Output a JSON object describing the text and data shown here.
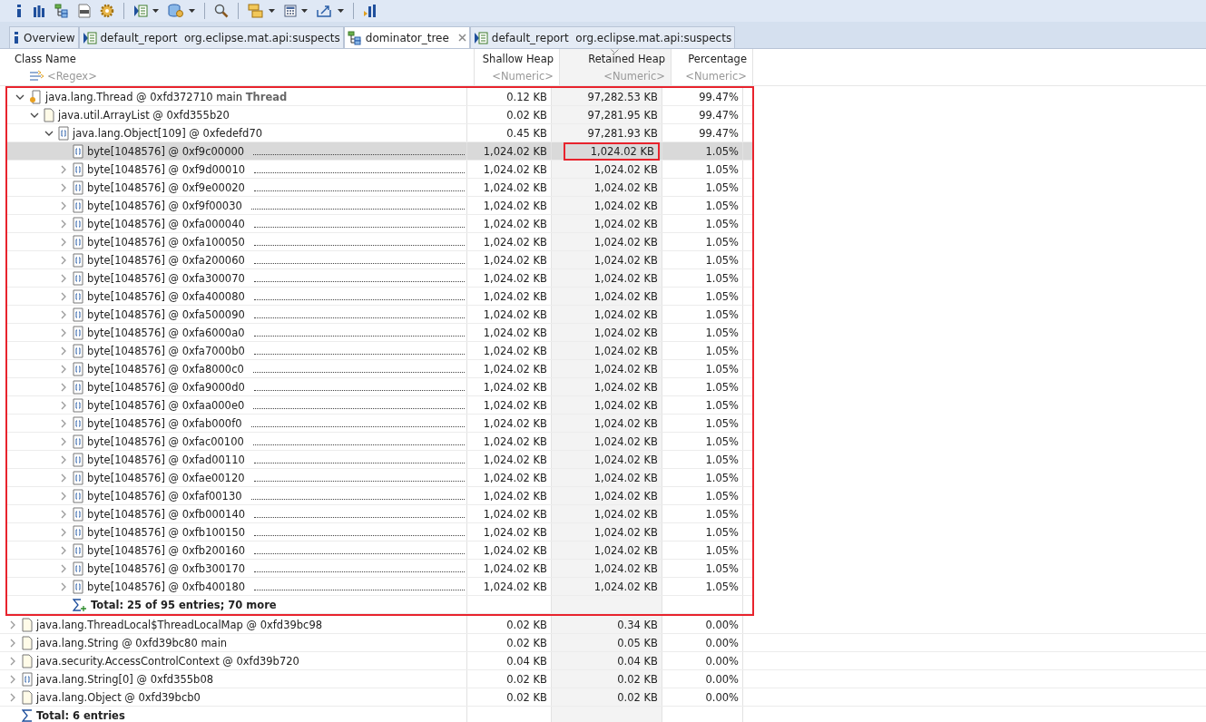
{
  "toolbar": [
    {
      "kind": "info"
    },
    {
      "kind": "histogram"
    },
    {
      "kind": "tree"
    },
    {
      "kind": "oql"
    },
    {
      "kind": "gear",
      "sep_after": true
    },
    {
      "kind": "report",
      "menu": true
    },
    {
      "kind": "db",
      "menu": true,
      "sep_after": true
    },
    {
      "kind": "search",
      "sep_after": true
    },
    {
      "kind": "stack",
      "menu": true
    },
    {
      "kind": "calc",
      "menu": true
    },
    {
      "kind": "export",
      "menu": true,
      "sep_after": true
    },
    {
      "kind": "pin"
    }
  ],
  "tabs": [
    {
      "kind": "info",
      "label": "Overview",
      "selected": false,
      "closable": false
    },
    {
      "kind": "report",
      "label": "default_report",
      "query": "org.eclipse.mat.api:suspects",
      "selected": false,
      "closable": false
    },
    {
      "kind": "tree",
      "label": "dominator_tree",
      "selected": true,
      "closable": true
    },
    {
      "kind": "report",
      "label": "default_report",
      "query": "org.eclipse.mat.api:suspects",
      "selected": false,
      "closable": false
    }
  ],
  "columns": [
    {
      "title": "Class Name",
      "filter": "<Regex>",
      "sorted": false
    },
    {
      "title": "Shallow Heap",
      "filter": "<Numeric>",
      "sorted": false
    },
    {
      "title": "Retained Heap",
      "filter": "<Numeric>",
      "sorted": true
    },
    {
      "title": "Percentage",
      "filter": "<Numeric>",
      "sorted": false
    }
  ],
  "rows": [
    {
      "kind": "thread",
      "name": "java.lang.Thread @ 0xfd372710  main",
      "type_label": "Thread",
      "shallow": "0.12 KB",
      "retained": "97,282.53 KB",
      "percentage": "99.47%",
      "expandable": true,
      "expanded": true,
      "selected": false,
      "annotated": true,
      "children": [
        {
          "kind": "object",
          "name": "java.util.ArrayList @ 0xfd355b20",
          "shallow": "0.02 KB",
          "retained": "97,281.95 KB",
          "percentage": "99.47%",
          "expandable": true,
          "expanded": true,
          "selected": false,
          "children": [
            {
              "kind": "array",
              "name": "java.lang.Object[109] @ 0xfedefd70",
              "shallow": "0.45 KB",
              "retained": "97,281.93 KB",
              "percentage": "99.47%",
              "expandable": true,
              "expanded": true,
              "selected": false,
              "children": [
                {
                  "kind": "array",
                  "name": "byte[1048576] @ 0xf9c00000",
                  "shallow": "1,024.02 KB",
                  "retained": "1,024.02 KB",
                  "percentage": "1.05%",
                  "expandable": false,
                  "selected": true,
                  "retained_annotated": true
                },
                {
                  "kind": "array",
                  "name": "byte[1048576] @ 0xf9d00010",
                  "shallow": "1,024.02 KB",
                  "retained": "1,024.02 KB",
                  "percentage": "1.05%",
                  "expandable": true,
                  "expanded": false,
                  "selected": false
                },
                {
                  "kind": "array",
                  "name": "byte[1048576] @ 0xf9e00020",
                  "shallow": "1,024.02 KB",
                  "retained": "1,024.02 KB",
                  "percentage": "1.05%",
                  "expandable": true,
                  "expanded": false,
                  "selected": false
                },
                {
                  "kind": "array",
                  "name": "byte[1048576] @ 0xf9f00030",
                  "shallow": "1,024.02 KB",
                  "retained": "1,024.02 KB",
                  "percentage": "1.05%",
                  "expandable": true,
                  "expanded": false,
                  "selected": false
                },
                {
                  "kind": "array",
                  "name": "byte[1048576] @ 0xfa000040",
                  "shallow": "1,024.02 KB",
                  "retained": "1,024.02 KB",
                  "percentage": "1.05%",
                  "expandable": true,
                  "expanded": false,
                  "selected": false
                },
                {
                  "kind": "array",
                  "name": "byte[1048576] @ 0xfa100050",
                  "shallow": "1,024.02 KB",
                  "retained": "1,024.02 KB",
                  "percentage": "1.05%",
                  "expandable": true,
                  "expanded": false,
                  "selected": false
                },
                {
                  "kind": "array",
                  "name": "byte[1048576] @ 0xfa200060",
                  "shallow": "1,024.02 KB",
                  "retained": "1,024.02 KB",
                  "percentage": "1.05%",
                  "expandable": true,
                  "expanded": false,
                  "selected": false
                },
                {
                  "kind": "array",
                  "name": "byte[1048576] @ 0xfa300070",
                  "shallow": "1,024.02 KB",
                  "retained": "1,024.02 KB",
                  "percentage": "1.05%",
                  "expandable": true,
                  "expanded": false,
                  "selected": false
                },
                {
                  "kind": "array",
                  "name": "byte[1048576] @ 0xfa400080",
                  "shallow": "1,024.02 KB",
                  "retained": "1,024.02 KB",
                  "percentage": "1.05%",
                  "expandable": true,
                  "expanded": false,
                  "selected": false
                },
                {
                  "kind": "array",
                  "name": "byte[1048576] @ 0xfa500090",
                  "shallow": "1,024.02 KB",
                  "retained": "1,024.02 KB",
                  "percentage": "1.05%",
                  "expandable": true,
                  "expanded": false,
                  "selected": false
                },
                {
                  "kind": "array",
                  "name": "byte[1048576] @ 0xfa6000a0",
                  "shallow": "1,024.02 KB",
                  "retained": "1,024.02 KB",
                  "percentage": "1.05%",
                  "expandable": true,
                  "expanded": false,
                  "selected": false
                },
                {
                  "kind": "array",
                  "name": "byte[1048576] @ 0xfa7000b0",
                  "shallow": "1,024.02 KB",
                  "retained": "1,024.02 KB",
                  "percentage": "1.05%",
                  "expandable": true,
                  "expanded": false,
                  "selected": false
                },
                {
                  "kind": "array",
                  "name": "byte[1048576] @ 0xfa8000c0",
                  "shallow": "1,024.02 KB",
                  "retained": "1,024.02 KB",
                  "percentage": "1.05%",
                  "expandable": true,
                  "expanded": false,
                  "selected": false
                },
                {
                  "kind": "array",
                  "name": "byte[1048576] @ 0xfa9000d0",
                  "shallow": "1,024.02 KB",
                  "retained": "1,024.02 KB",
                  "percentage": "1.05%",
                  "expandable": true,
                  "expanded": false,
                  "selected": false
                },
                {
                  "kind": "array",
                  "name": "byte[1048576] @ 0xfaa000e0",
                  "shallow": "1,024.02 KB",
                  "retained": "1,024.02 KB",
                  "percentage": "1.05%",
                  "expandable": true,
                  "expanded": false,
                  "selected": false
                },
                {
                  "kind": "array",
                  "name": "byte[1048576] @ 0xfab000f0",
                  "shallow": "1,024.02 KB",
                  "retained": "1,024.02 KB",
                  "percentage": "1.05%",
                  "expandable": true,
                  "expanded": false,
                  "selected": false
                },
                {
                  "kind": "array",
                  "name": "byte[1048576] @ 0xfac00100",
                  "shallow": "1,024.02 KB",
                  "retained": "1,024.02 KB",
                  "percentage": "1.05%",
                  "expandable": true,
                  "expanded": false,
                  "selected": false
                },
                {
                  "kind": "array",
                  "name": "byte[1048576] @ 0xfad00110",
                  "shallow": "1,024.02 KB",
                  "retained": "1,024.02 KB",
                  "percentage": "1.05%",
                  "expandable": true,
                  "expanded": false,
                  "selected": false
                },
                {
                  "kind": "array",
                  "name": "byte[1048576] @ 0xfae00120",
                  "shallow": "1,024.02 KB",
                  "retained": "1,024.02 KB",
                  "percentage": "1.05%",
                  "expandable": true,
                  "expanded": false,
                  "selected": false
                },
                {
                  "kind": "array",
                  "name": "byte[1048576] @ 0xfaf00130",
                  "shallow": "1,024.02 KB",
                  "retained": "1,024.02 KB",
                  "percentage": "1.05%",
                  "expandable": true,
                  "expanded": false,
                  "selected": false
                },
                {
                  "kind": "array",
                  "name": "byte[1048576] @ 0xfb000140",
                  "shallow": "1,024.02 KB",
                  "retained": "1,024.02 KB",
                  "percentage": "1.05%",
                  "expandable": true,
                  "expanded": false,
                  "selected": false
                },
                {
                  "kind": "array",
                  "name": "byte[1048576] @ 0xfb100150",
                  "shallow": "1,024.02 KB",
                  "retained": "1,024.02 KB",
                  "percentage": "1.05%",
                  "expandable": true,
                  "expanded": false,
                  "selected": false
                },
                {
                  "kind": "array",
                  "name": "byte[1048576] @ 0xfb200160",
                  "shallow": "1,024.02 KB",
                  "retained": "1,024.02 KB",
                  "percentage": "1.05%",
                  "expandable": true,
                  "expanded": false,
                  "selected": false
                },
                {
                  "kind": "array",
                  "name": "byte[1048576] @ 0xfb300170",
                  "shallow": "1,024.02 KB",
                  "retained": "1,024.02 KB",
                  "percentage": "1.05%",
                  "expandable": true,
                  "expanded": false,
                  "selected": false
                },
                {
                  "kind": "array",
                  "name": "byte[1048576] @ 0xfb400180",
                  "shallow": "1,024.02 KB",
                  "retained": "1,024.02 KB",
                  "percentage": "1.05%",
                  "expandable": true,
                  "expanded": false,
                  "selected": false
                },
                {
                  "kind": "more",
                  "name": "Total: 25 of 95 entries; 70 more"
                }
              ]
            }
          ]
        }
      ]
    },
    {
      "kind": "object",
      "name": "java.lang.ThreadLocal$ThreadLocalMap @ 0xfd39bc98",
      "shallow": "0.02 KB",
      "retained": "0.34 KB",
      "percentage": "0.00%",
      "expandable": true,
      "expanded": false,
      "selected": false
    },
    {
      "kind": "object",
      "name": "java.lang.String @ 0xfd39bc80  main",
      "shallow": "0.02 KB",
      "retained": "0.05 KB",
      "percentage": "0.00%",
      "expandable": true,
      "expanded": false,
      "selected": false
    },
    {
      "kind": "object",
      "name": "java.security.AccessControlContext @ 0xfd39b720",
      "shallow": "0.04 KB",
      "retained": "0.04 KB",
      "percentage": "0.00%",
      "expandable": true,
      "expanded": false,
      "selected": false
    },
    {
      "kind": "array",
      "name": "java.lang.String[0] @ 0xfd355b08",
      "shallow": "0.02 KB",
      "retained": "0.02 KB",
      "percentage": "0.00%",
      "expandable": true,
      "expanded": false,
      "selected": false
    },
    {
      "kind": "object",
      "name": "java.lang.Object @ 0xfd39bcb0",
      "shallow": "0.02 KB",
      "retained": "0.02 KB",
      "percentage": "0.00%",
      "expandable": true,
      "expanded": false,
      "selected": false
    },
    {
      "kind": "total",
      "name": "Total: 6 entries"
    }
  ]
}
